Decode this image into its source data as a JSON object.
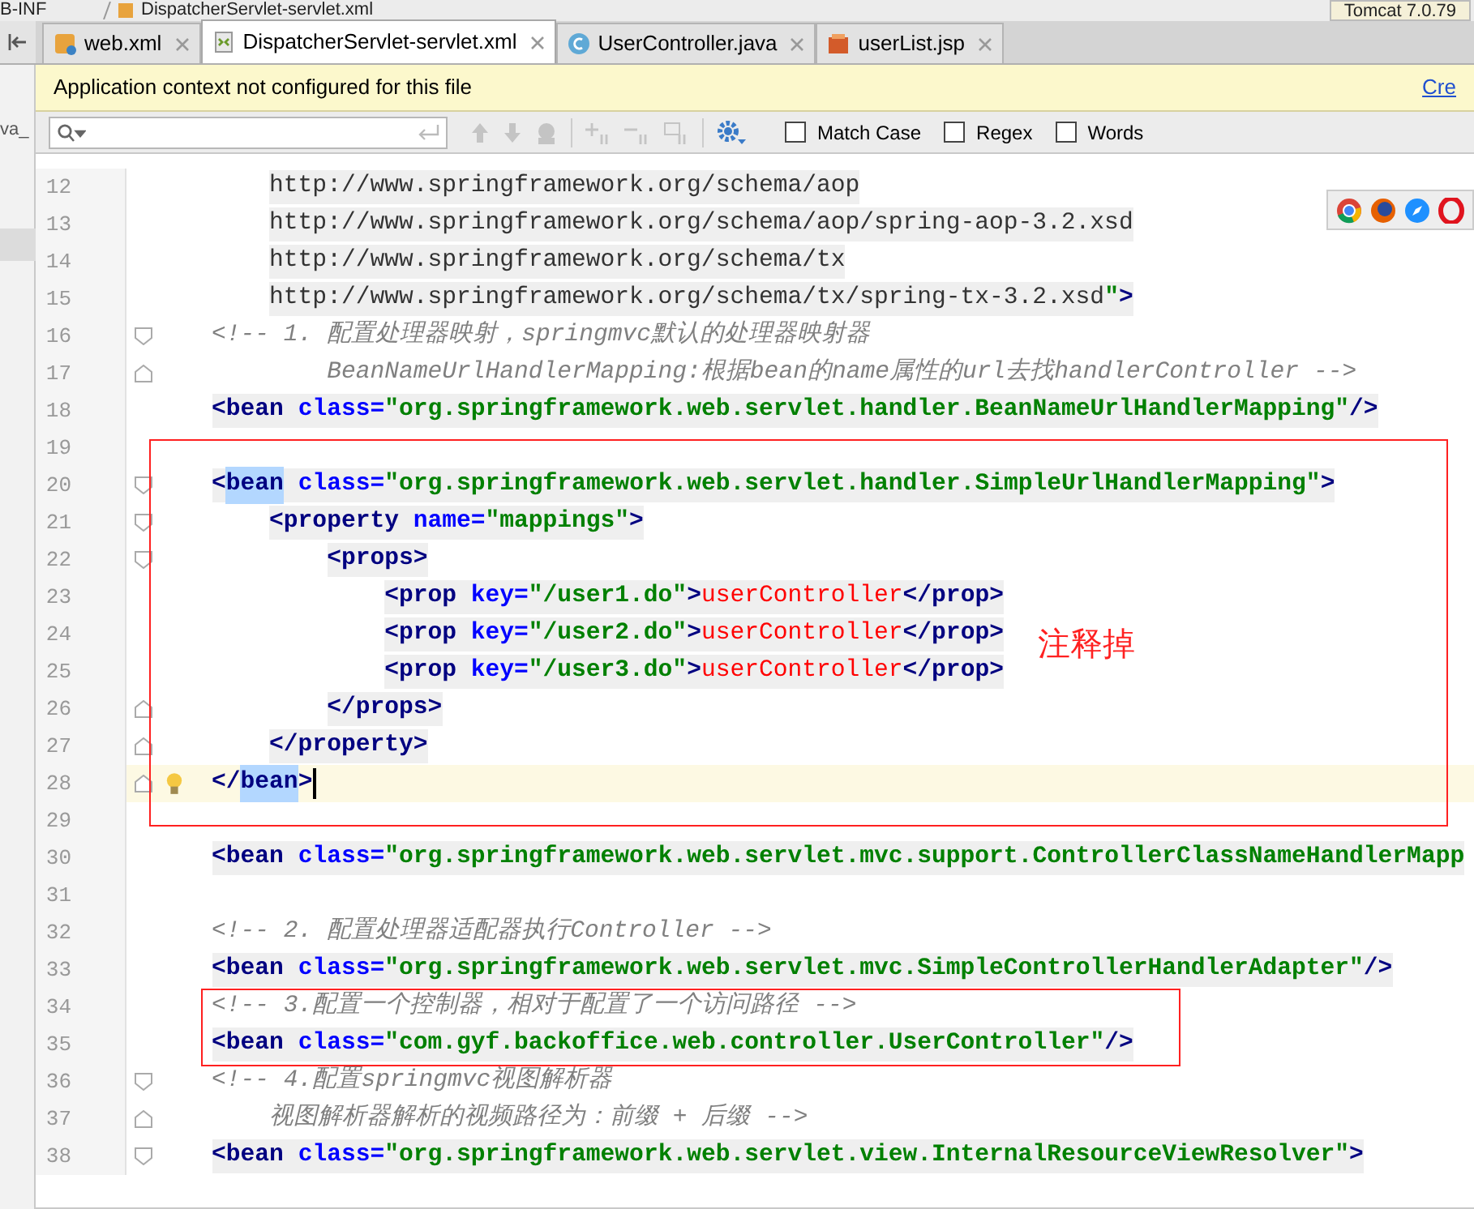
{
  "breadcrumb": {
    "items": [
      "B-INF",
      "DispatcherServlet-servlet.xml"
    ],
    "run_config": "Tomcat 7.0.79"
  },
  "project_panel": {
    "label": "va_"
  },
  "tabs": [
    {
      "label": "web.xml",
      "kind": "xml",
      "selected": false
    },
    {
      "label": "DispatcherServlet-servlet.xml",
      "kind": "spring",
      "selected": true
    },
    {
      "label": "UserController.java",
      "kind": "class",
      "selected": false
    },
    {
      "label": "userList.jsp",
      "kind": "jsp",
      "selected": false
    }
  ],
  "notification": {
    "text": "Application context not configured for this file",
    "link": "Cre"
  },
  "search": {
    "options": [
      {
        "label": "Match Case",
        "checked": false
      },
      {
        "label": "Regex",
        "checked": false
      },
      {
        "label": "Words",
        "checked": false
      }
    ]
  },
  "annotations": [
    {
      "kind": "note_box",
      "note": "注释掉"
    },
    {
      "kind": "box"
    }
  ],
  "lines": [
    {
      "number": "12",
      "shaded": true,
      "tokens": [
        {
          "kind": "plain",
          "text": "        http://www.springframework.org/schema/aop"
        }
      ]
    },
    {
      "number": "13",
      "shaded": true,
      "tokens": [
        {
          "kind": "plain",
          "text": "        http://www.springframework.org/schema/aop/spring-aop-3.2.xsd"
        }
      ]
    },
    {
      "number": "14",
      "shaded": true,
      "tokens": [
        {
          "kind": "plain",
          "text": "        http://www.springframework.org/schema/tx"
        }
      ]
    },
    {
      "number": "15",
      "shaded": true,
      "tokens": [
        {
          "kind": "plain",
          "text": "        http://www.springframework.org/schema/tx/spring-tx-3.2.xsd"
        },
        {
          "kind": "value",
          "text": "\""
        },
        {
          "kind": "tag",
          "text": ">"
        }
      ]
    },
    {
      "number": "16",
      "fold_start": true,
      "tokens": [
        {
          "kind": "comment",
          "text": "    <!-- 1. 配置处理器映射，springmvc默认的处理器映射器"
        }
      ]
    },
    {
      "number": "17",
      "fold_end": true,
      "tokens": [
        {
          "kind": "comment",
          "text": "            BeanNameUrlHandlerMapping:根据bean的name属性的url去找handlerController -->"
        }
      ]
    },
    {
      "number": "18",
      "shaded": true,
      "tokens": [
        {
          "kind": "tag",
          "text": "    <bean"
        },
        {
          "kind": "attr",
          "text": " class="
        },
        {
          "kind": "value",
          "text": "\"org.springframework.web.servlet.handler.BeanNameUrlHandlerMapping\""
        },
        {
          "kind": "tag",
          "text": "/>"
        }
      ]
    },
    {
      "number": "19"
    },
    {
      "number": "20",
      "fold_start": true,
      "shaded": true,
      "tokens": [
        {
          "kind": "match",
          "text": "    <bean"
        },
        {
          "kind": "attr",
          "text": " class="
        },
        {
          "kind": "value",
          "text": "\"org.springframework.web.servlet.handler.SimpleUrlHandlerMapping\""
        },
        {
          "kind": "tag",
          "text": ">"
        }
      ]
    },
    {
      "number": "21",
      "fold_start": true,
      "shaded": true,
      "tokens": [
        {
          "kind": "tag",
          "text": "        <property"
        },
        {
          "kind": "attr",
          "text": " name="
        },
        {
          "kind": "value",
          "text": "\"mappings\""
        },
        {
          "kind": "tag",
          "text": ">"
        }
      ]
    },
    {
      "number": "22",
      "fold_start": true,
      "shaded": true,
      "tokens": [
        {
          "kind": "tag",
          "text": "            <props>"
        }
      ]
    },
    {
      "number": "23",
      "shaded": true,
      "tokens": [
        {
          "kind": "tag",
          "text": "                <prop"
        },
        {
          "kind": "attr",
          "text": " key="
        },
        {
          "kind": "value",
          "text": "\"/user1.do\""
        },
        {
          "kind": "tag",
          "text": ">"
        },
        {
          "kind": "text",
          "text": "userController"
        },
        {
          "kind": "tag",
          "text": "</prop>"
        }
      ]
    },
    {
      "number": "24",
      "shaded": true,
      "tokens": [
        {
          "kind": "tag",
          "text": "                <prop"
        },
        {
          "kind": "attr",
          "text": " key="
        },
        {
          "kind": "value",
          "text": "\"/user2.do\""
        },
        {
          "kind": "tag",
          "text": ">"
        },
        {
          "kind": "text",
          "text": "userController"
        },
        {
          "kind": "tag",
          "text": "</prop>"
        }
      ]
    },
    {
      "number": "25",
      "shaded": true,
      "tokens": [
        {
          "kind": "tag",
          "text": "                <prop"
        },
        {
          "kind": "attr",
          "text": " key="
        },
        {
          "kind": "value",
          "text": "\"/user3.do\""
        },
        {
          "kind": "tag",
          "text": ">"
        },
        {
          "kind": "text",
          "text": "userController"
        },
        {
          "kind": "tag",
          "text": "</prop>"
        }
      ]
    },
    {
      "number": "26",
      "fold_end": true,
      "shaded": true,
      "tokens": [
        {
          "kind": "tag",
          "text": "            </props>"
        }
      ]
    },
    {
      "number": "27",
      "fold_end": true,
      "shaded": true,
      "tokens": [
        {
          "kind": "tag",
          "text": "        </property>"
        }
      ]
    },
    {
      "number": "28",
      "fold_end": true,
      "current": true,
      "bulb": true,
      "tokens": [
        {
          "kind": "match",
          "text": "    </bean"
        },
        {
          "kind": "tag",
          "text": ">"
        }
      ]
    },
    {
      "number": "29"
    },
    {
      "number": "30",
      "shaded": true,
      "tokens": [
        {
          "kind": "tag",
          "text": "    <bean"
        },
        {
          "kind": "attr",
          "text": " class="
        },
        {
          "kind": "value",
          "text": "\"org.springframework.web.servlet.mvc.support.ControllerClassNameHandlerMapp"
        }
      ]
    },
    {
      "number": "31"
    },
    {
      "number": "32",
      "tokens": [
        {
          "kind": "comment",
          "text": "    <!-- 2. 配置处理器适配器执行Controller -->"
        }
      ]
    },
    {
      "number": "33",
      "shaded": true,
      "tokens": [
        {
          "kind": "tag",
          "text": "    <bean"
        },
        {
          "kind": "attr",
          "text": " class="
        },
        {
          "kind": "value",
          "text": "\"org.springframework.web.servlet.mvc.SimpleControllerHandlerAdapter\""
        },
        {
          "kind": "tag",
          "text": "/>"
        }
      ]
    },
    {
      "number": "34",
      "tokens": [
        {
          "kind": "comment",
          "text": "    <!-- 3.配置一个控制器，相对于配置了一个访问路径 -->"
        }
      ]
    },
    {
      "number": "35",
      "shaded": true,
      "tokens": [
        {
          "kind": "tag",
          "text": "    <bean"
        },
        {
          "kind": "attr",
          "text": " class="
        },
        {
          "kind": "value",
          "text": "\"com.gyf.backoffice.web.controller.UserController\""
        },
        {
          "kind": "tag",
          "text": "/>"
        }
      ]
    },
    {
      "number": "36",
      "fold_start": true,
      "tokens": [
        {
          "kind": "comment",
          "text": "    <!-- 4.配置springmvc视图解析器"
        }
      ]
    },
    {
      "number": "37",
      "fold_end": true,
      "tokens": [
        {
          "kind": "comment",
          "text": "        视图解析器解析的视频路径为：前缀 + 后缀 -->"
        }
      ]
    },
    {
      "number": "38",
      "fold_start": true,
      "shaded": true,
      "tokens": [
        {
          "kind": "tag",
          "text": "    <bean"
        },
        {
          "kind": "attr",
          "text": " class="
        },
        {
          "kind": "value",
          "text": "\"org.springframework.web.servlet.view.InternalResourceViewResolver\""
        },
        {
          "kind": "tag",
          "text": ">"
        }
      ]
    }
  ]
}
